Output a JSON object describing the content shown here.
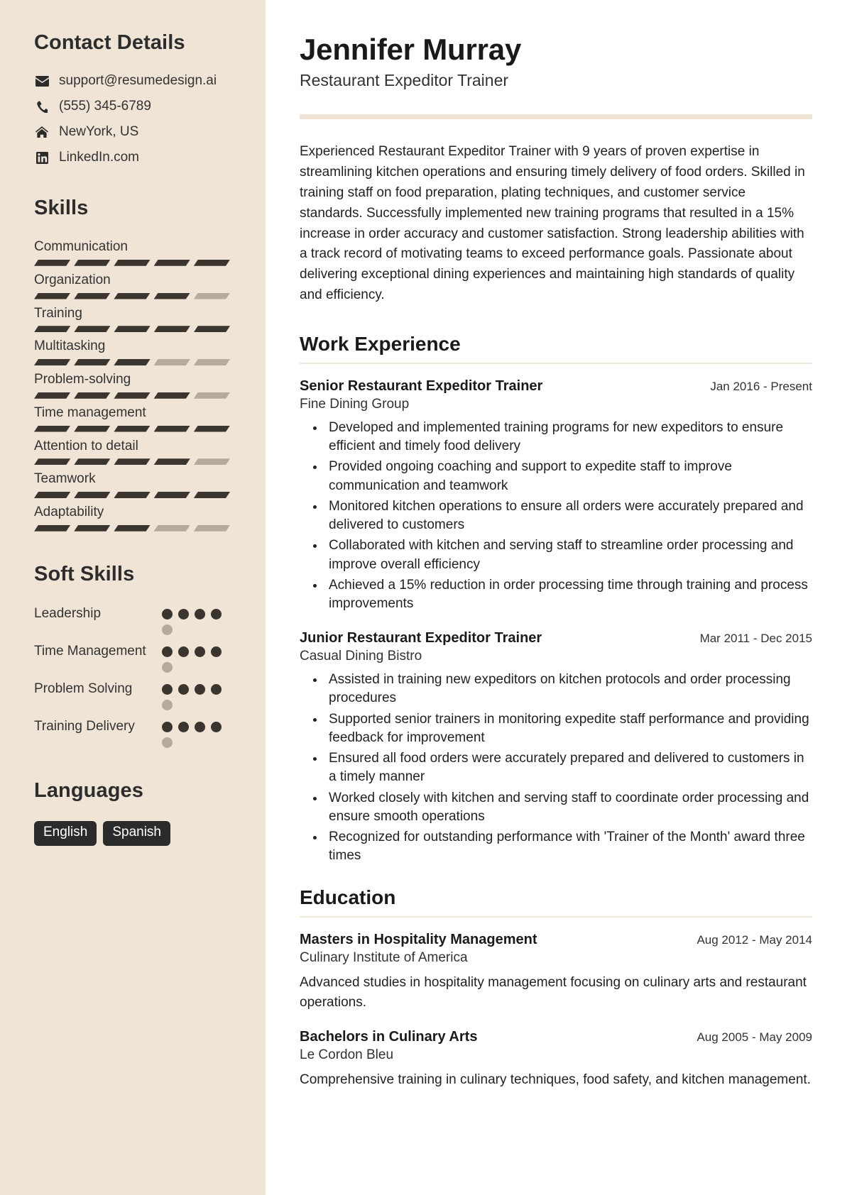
{
  "sidebar": {
    "contact": {
      "heading": "Contact Details",
      "items": [
        {
          "icon": "envelope-icon",
          "value": "support@resumedesign.ai"
        },
        {
          "icon": "phone-icon",
          "value": "(555) 345-6789"
        },
        {
          "icon": "home-icon",
          "value": "NewYork, US"
        },
        {
          "icon": "linkedin-icon",
          "value": "LinkedIn.com"
        }
      ]
    },
    "skills": {
      "heading": "Skills",
      "max": 5,
      "items": [
        {
          "label": "Communication",
          "level": 5
        },
        {
          "label": "Organization",
          "level": 4
        },
        {
          "label": "Training",
          "level": 5
        },
        {
          "label": "Multitasking",
          "level": 3
        },
        {
          "label": "Problem-solving",
          "level": 4
        },
        {
          "label": "Time management",
          "level": 5
        },
        {
          "label": "Attention to detail",
          "level": 4
        },
        {
          "label": "Teamwork",
          "level": 5
        },
        {
          "label": "Adaptability",
          "level": 3
        }
      ]
    },
    "soft_skills": {
      "heading": "Soft Skills",
      "max": 5,
      "items": [
        {
          "label": "Leadership",
          "level": 4
        },
        {
          "label": "Time Management",
          "level": 4
        },
        {
          "label": "Problem Solving",
          "level": 4
        },
        {
          "label": "Training Delivery",
          "level": 4
        }
      ]
    },
    "languages": {
      "heading": "Languages",
      "items": [
        "English",
        "Spanish"
      ]
    }
  },
  "main": {
    "name": "Jennifer Murray",
    "role": "Restaurant Expeditor Trainer",
    "summary": "Experienced Restaurant Expeditor Trainer with 9 years of proven expertise in streamlining kitchen operations and ensuring timely delivery of food orders. Skilled in training staff on food preparation, plating techniques, and customer service standards. Successfully implemented new training programs that resulted in a 15% increase in order accuracy and customer satisfaction. Strong leadership abilities with a track record of motivating teams to exceed performance goals. Passionate about delivering exceptional dining experiences and maintaining high standards of quality and efficiency.",
    "work": {
      "heading": "Work Experience",
      "entries": [
        {
          "title": "Senior Restaurant Expeditor Trainer",
          "company": "Fine Dining Group",
          "date": "Jan 2016 - Present",
          "bullets": [
            "Developed and implemented training programs for new expeditors to ensure efficient and timely food delivery",
            "Provided ongoing coaching and support to expedite staff to improve communication and teamwork",
            "Monitored kitchen operations to ensure all orders were accurately prepared and delivered to customers",
            "Collaborated with kitchen and serving staff to streamline order processing and improve overall efficiency",
            "Achieved a 15% reduction in order processing time through training and process improvements"
          ]
        },
        {
          "title": "Junior Restaurant Expeditor Trainer",
          "company": "Casual Dining Bistro",
          "date": "Mar 2011 - Dec 2015",
          "bullets": [
            "Assisted in training new expeditors on kitchen protocols and order processing procedures",
            "Supported senior trainers in monitoring expedite staff performance and providing feedback for improvement",
            "Ensured all food orders were accurately prepared and delivered to customers in a timely manner",
            "Worked closely with kitchen and serving staff to coordinate order processing and ensure smooth operations",
            "Recognized for outstanding performance with 'Trainer of the Month' award three times"
          ]
        }
      ]
    },
    "education": {
      "heading": "Education",
      "entries": [
        {
          "title": "Masters in Hospitality Management",
          "school": "Culinary Institute of America",
          "date": "Aug 2012 - May 2014",
          "description": "Advanced studies in hospitality management focusing on culinary arts and restaurant operations."
        },
        {
          "title": "Bachelors in Culinary Arts",
          "school": "Le Cordon Bleu",
          "date": "Aug 2005 - May 2009",
          "description": "Comprehensive training in culinary techniques, food safety, and kitchen management."
        }
      ]
    }
  }
}
